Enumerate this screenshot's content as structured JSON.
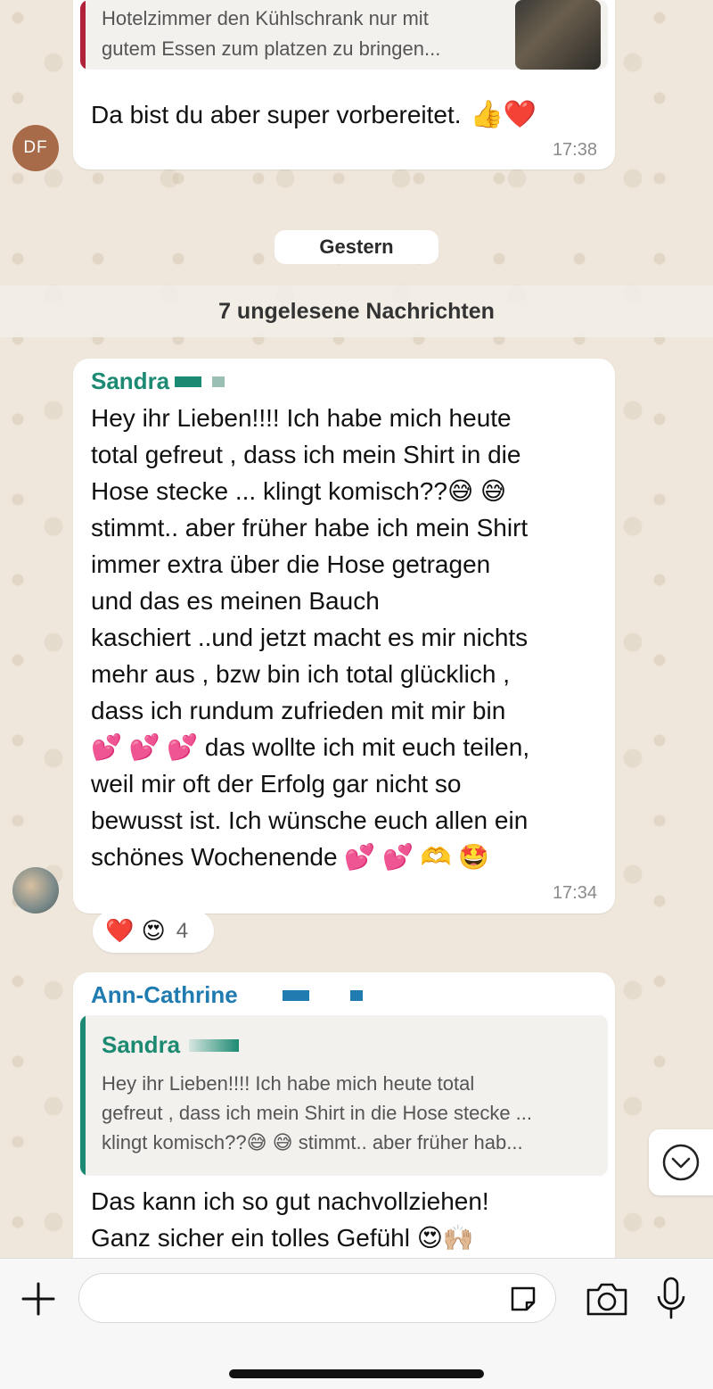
{
  "top_message": {
    "quote_line1": "Hotelzimmer den Kühlschrank nur mit",
    "quote_line2": "gutem Essen zum platzen zu bringen...",
    "text": "Da bist du aber super vorbereitet.",
    "emojis": "👍❤️",
    "time": "17:38",
    "avatar_initials": "DF"
  },
  "date_divider": "Gestern",
  "unread_banner": "7 ungelesene Nachrichten",
  "sandra_message": {
    "sender": "Sandra",
    "lines": [
      "Hey ihr Lieben!!!! Ich habe mich heute",
      "total gefreut , dass ich mein Shirt in die",
      "Hose stecke ... klingt komisch??😅 😅",
      "stimmt.. aber früher habe ich mein Shirt",
      "immer extra über die Hose getragen",
      "und das es meinen Bauch",
      "kaschiert ..und jetzt macht es mir nichts",
      "mehr aus , bzw bin ich total glücklich ,",
      "dass ich rundum zufrieden mit mir bin",
      "💕 💕 💕  das wollte ich mit euch teilen,",
      "weil mir oft der Erfolg gar nicht so",
      "bewusst ist. Ich wünsche euch allen ein",
      "schönes Wochenende 💕 💕 🫶 🤩"
    ],
    "time": "17:34",
    "reactions": "❤️ 😍",
    "reaction_count": "4"
  },
  "ann_message": {
    "sender": "Ann-Cathrine",
    "quote_sender": "Sandra",
    "quote_lines": [
      "Hey ihr Lieben!!!! Ich habe mich heute total",
      "gefreut , dass ich mein Shirt in die Hose stecke ...",
      "klingt komisch??😅 😅  stimmt.. aber früher hab..."
    ],
    "lines": [
      "Das kann ich so gut nachvollziehen!",
      "Ganz sicher ein tolles Gefühl 😍🙌🏼"
    ]
  },
  "colors": {
    "sandra_name": "#1c8a72",
    "ann_name": "#1f7bb0",
    "quote_bar_top": "#b0213a",
    "quote_bar_ann": "#1c8a72",
    "df_avatar": "#a86b4a"
  },
  "icons": [
    "plus-icon",
    "sticker-icon",
    "camera-icon",
    "microphone-icon",
    "scroll-down-icon"
  ]
}
